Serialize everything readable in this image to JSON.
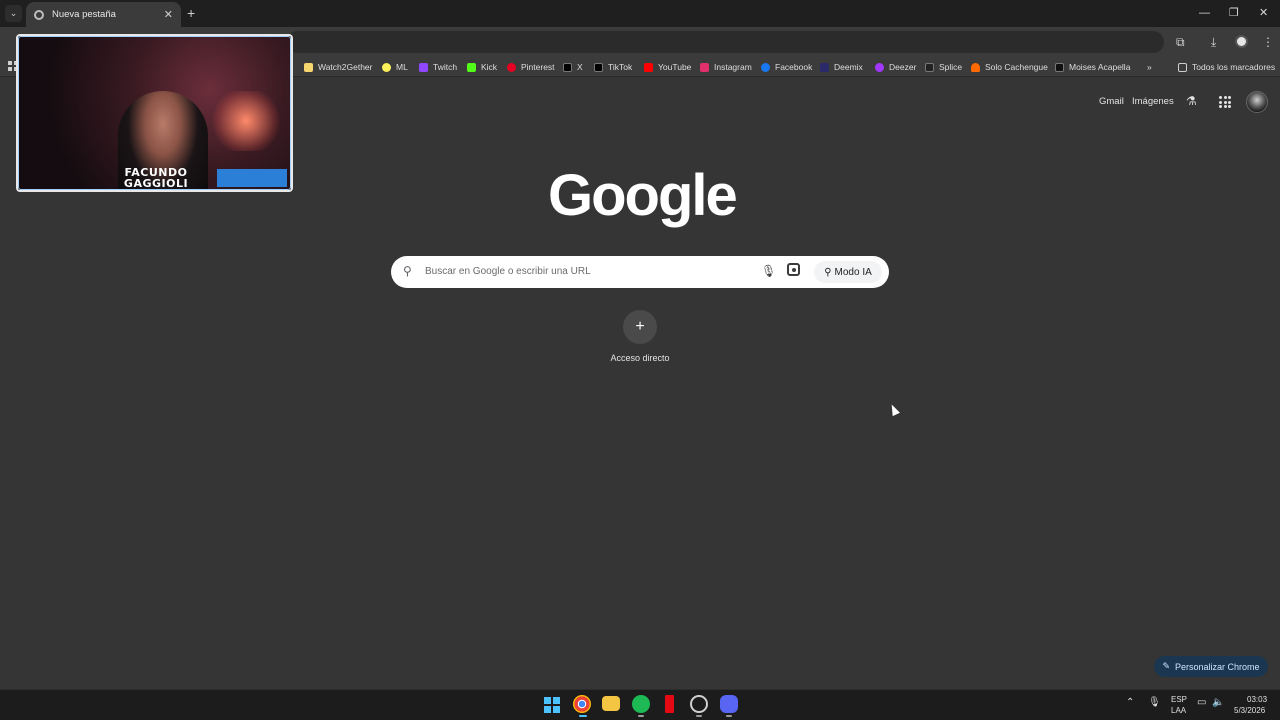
{
  "tab": {
    "title": "Nueva pestaña",
    "close": "✕",
    "new_tab": "+"
  },
  "window_controls": {
    "minimize": "—",
    "restore": "❐",
    "close": "✕"
  },
  "bookmarks": [
    {
      "label": "Watch2Gether",
      "color": "#f5d76e"
    },
    {
      "label": "ML",
      "color": "#fff159"
    },
    {
      "label": "Twitch",
      "color": "#9146ff"
    },
    {
      "label": "Kick",
      "color": "#53fc18"
    },
    {
      "label": "Pinterest",
      "color": "#e60023"
    },
    {
      "label": "X",
      "color": "#000000"
    },
    {
      "label": "TikTok",
      "color": "#000000"
    },
    {
      "label": "YouTube",
      "color": "#ff0000"
    },
    {
      "label": "Instagram",
      "color": "#e1306c"
    },
    {
      "label": "Facebook",
      "color": "#1877f2"
    },
    {
      "label": "Deemix",
      "color": "#2a2a6a"
    },
    {
      "label": "Deezer",
      "color": "#a238ff"
    },
    {
      "label": "Splice",
      "color": "#222222"
    },
    {
      "label": "Solo Cachengue",
      "color": "#ff6a00"
    },
    {
      "label": "Moises Acapella",
      "color": "#111111"
    }
  ],
  "bookmarks_overflow": "»",
  "all_bookmarks": "Todos los marcadores",
  "webcam": {
    "overlay_text": "FACUNDO GAGGIOLI"
  },
  "header": {
    "gmail": "Gmail",
    "images": "Imágenes"
  },
  "logo": "Google",
  "search": {
    "placeholder": "Buscar en Google o escribir una URL",
    "ai_mode": "Modo IA"
  },
  "shortcut": {
    "label": "Acceso directo",
    "add": "+"
  },
  "customize": {
    "label": "Personalizar Chrome"
  },
  "taskbar": {
    "apps": [
      {
        "name": "chrome",
        "color": "#4285f4"
      },
      {
        "name": "file-explorer",
        "color": "#f4c542"
      },
      {
        "name": "spotify",
        "color": "#1db954"
      },
      {
        "name": "netflix",
        "color": "#e50914"
      },
      {
        "name": "app",
        "color": "#cfcfcf"
      },
      {
        "name": "discord",
        "color": "#5865f2"
      }
    ],
    "language": "ESP",
    "layout": "LAA",
    "time": "03:03",
    "date": "5/3/2026"
  },
  "colors": {
    "accent": "#1a3650",
    "background": "#353535"
  }
}
